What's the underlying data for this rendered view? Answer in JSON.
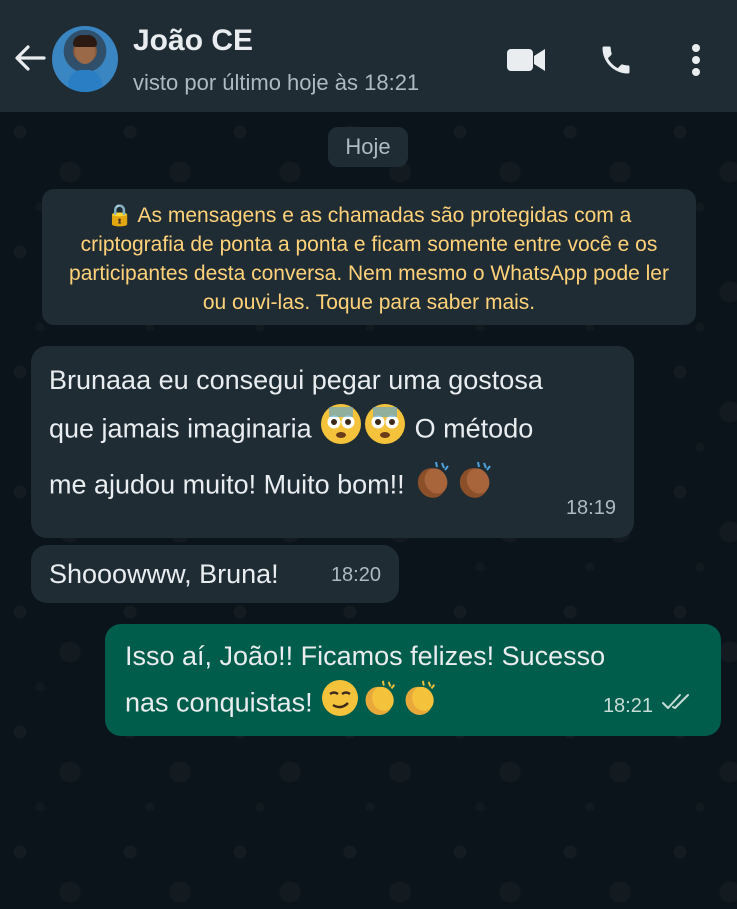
{
  "header": {
    "contact_name": "João CE",
    "last_seen": "visto por último hoje às 18:21",
    "icons": [
      "back-arrow-icon",
      "avatar",
      "video-call-icon",
      "phone-icon",
      "more-options-icon"
    ]
  },
  "date_separator": "Hoje",
  "encryption_notice": "🔒 As mensagens e as chamadas são protegidas com a criptografia de ponta a ponta e ficam somente entre você e os participantes desta conversa. Nem mesmo o WhatsApp pode ler ou ouvi-las. Toque para saber mais.",
  "messages": [
    {
      "direction": "incoming",
      "line1": "Brunaaa eu consegui pegar uma gostosa",
      "line2": "que jamais imaginaria",
      "line2_suffix": "O método",
      "line3": "me ajudou muito! Muito bom!!",
      "time": "18:19"
    },
    {
      "direction": "incoming",
      "text": "Shooowww, Bruna!",
      "time": "18:20"
    },
    {
      "direction": "outgoing",
      "line1": "Isso aí, João!! Ficamos felizes! Sucesso",
      "line2": "nas conquistas!",
      "time": "18:21",
      "status": "read"
    }
  ],
  "colors": {
    "header_bg": "#1f2c34",
    "chat_bg": "#0b141a",
    "incoming_bubble": "#1f2c34",
    "outgoing_bubble": "#005c4b",
    "notice_text": "#ffd279",
    "read_ticks": "#c6dcd6"
  }
}
